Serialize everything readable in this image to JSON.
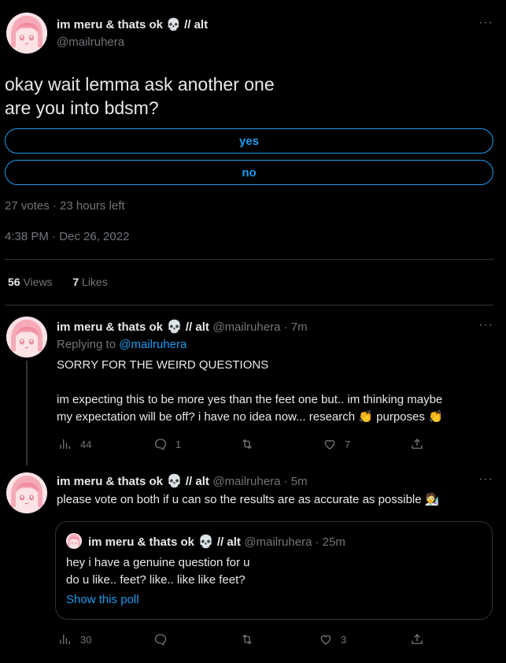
{
  "main_tweet": {
    "display_name": "im meru & thats ok",
    "name_suffix": "// alt",
    "handle": "@mailruhera",
    "text_line1": "okay wait lemma ask another one",
    "text_line2": "are you into bdsm?",
    "poll_options": [
      "yes",
      "no"
    ],
    "poll_meta": "27 votes · 23 hours left",
    "timestamp": "4:38 PM · Dec 26, 2022",
    "views_count": "56",
    "views_label": "Views",
    "likes_count": "7",
    "likes_label": "Likes"
  },
  "reply1": {
    "display_name": "im meru & thats ok",
    "name_suffix": "// alt",
    "handle_time": "@mailruhera · 7m",
    "replying_label": "Replying to",
    "replying_handle": "@mailruhera",
    "line1": "SORRY FOR THE WEIRD QUESTIONS",
    "line2": "im expecting this to be more yes than the feet one but.. im thinking maybe",
    "line3a": "my expectation will be off? i have no idea now... research",
    "line3b": "purposes",
    "emoji_clap": "👏",
    "views": "44",
    "replies": "1",
    "retweets": "",
    "likes": "7"
  },
  "reply2": {
    "display_name": "im meru & thats ok",
    "name_suffix": "// alt",
    "handle_time": "@mailruhera · 5m",
    "text": "please vote on both if u can so the results are as accurate as possible",
    "emoji_end": "🧑‍🔬",
    "views": "30",
    "replies": "",
    "retweets": "",
    "likes": "3",
    "quote": {
      "display_name": "im meru & thats ok",
      "name_suffix": "// alt",
      "handle_time": "@mailruhera · 25m",
      "line1": "hey i have a genuine question for u",
      "line2": "do u like.. feet? like.. like like feet?",
      "show_poll": "Show this poll"
    }
  },
  "more_glyph": "···",
  "skull": "💀",
  "colors": {
    "accent": "#1d9bf0",
    "muted": "#71767b",
    "text": "#e7e9ea",
    "bg": "#000000",
    "border": "#2f3336"
  }
}
